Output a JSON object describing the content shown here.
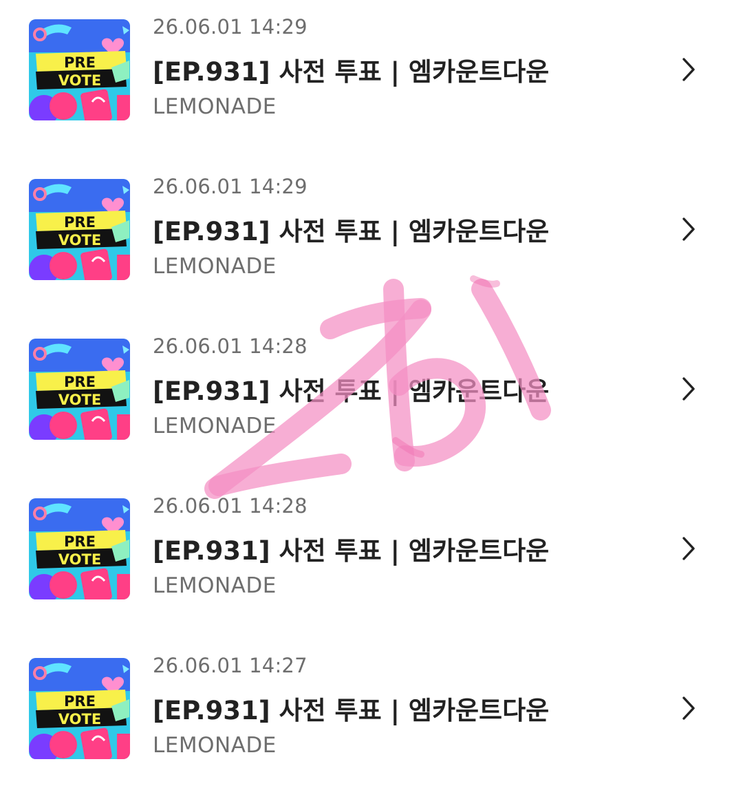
{
  "colors": {
    "background": "#ffffff",
    "title_text": "#222222",
    "meta_text": "#6e6e6e",
    "scribble": "#f48fc3"
  },
  "items": [
    {
      "date": "26.06.01 14:29",
      "title": "[EP.931] 사전 투표 | 엠카운트다운",
      "artist": "LEMONADE",
      "thumb_line1": "PRE",
      "thumb_line2": "VOTE",
      "chevron_icon": "chevron-right-icon"
    },
    {
      "date": "26.06.01 14:29",
      "title": "[EP.931] 사전 투표 | 엠카운트다운",
      "artist": "LEMONADE",
      "thumb_line1": "PRE",
      "thumb_line2": "VOTE",
      "chevron_icon": "chevron-right-icon"
    },
    {
      "date": "26.06.01 14:28",
      "title": "[EP.931] 사전 투표 | 엠카운트다운",
      "artist": "LEMONADE",
      "thumb_line1": "PRE",
      "thumb_line2": "VOTE",
      "chevron_icon": "chevron-right-icon"
    },
    {
      "date": "26.06.01 14:28",
      "title": "[EP.931] 사전 투표 | 엠카운트다운",
      "artist": "LEMONADE",
      "thumb_line1": "PRE",
      "thumb_line2": "VOTE",
      "chevron_icon": "chevron-right-icon"
    },
    {
      "date": "26.06.01 14:27",
      "title": "[EP.931] 사전 투표 | 엠카운트다운",
      "artist": "LEMONADE",
      "thumb_line1": "PRE",
      "thumb_line2": "VOTE",
      "chevron_icon": "chevron-right-icon"
    }
  ],
  "overlay": {
    "handwritten_mark": "zb|"
  }
}
